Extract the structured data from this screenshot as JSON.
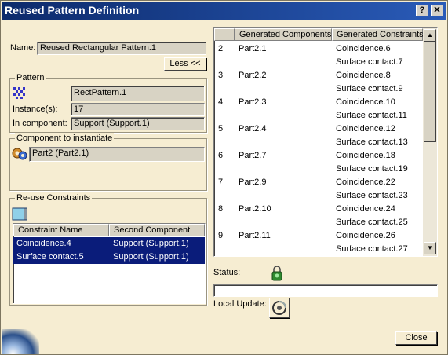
{
  "window": {
    "title": "Reused Pattern Definition",
    "help_button": "?",
    "close_button": "✕"
  },
  "name_section": {
    "label": "Name:",
    "value": "Reused Rectangular Pattern.1",
    "less_button": "Less <<"
  },
  "pattern": {
    "title": "Pattern",
    "pattern_value": "RectPattern.1",
    "instances_label": "Instance(s):",
    "instances_value": "17",
    "component_label": "In component:",
    "component_value": "Support (Support.1)"
  },
  "component_to_instantiate": {
    "title": "Component to instantiate",
    "value": "Part2 (Part2.1)"
  },
  "reuse_constraints": {
    "title": "Re-use Constraints",
    "columns": [
      "Constraint Name",
      "Second Component"
    ],
    "rows": [
      {
        "constraint": "Coincidence.4",
        "second": "Support (Support.1)",
        "selected": true
      },
      {
        "constraint": "Surface contact.5",
        "second": "Support (Support.1)",
        "selected": true
      }
    ]
  },
  "generated": {
    "columns": [
      "",
      "Generated Components",
      "Generated Constraints"
    ],
    "rows": [
      {
        "index": "2",
        "component": "Part2.1",
        "constraints": [
          "Coincidence.6",
          "Surface contact.7"
        ]
      },
      {
        "index": "3",
        "component": "Part2.2",
        "constraints": [
          "Coincidence.8",
          "Surface contact.9"
        ]
      },
      {
        "index": "4",
        "component": "Part2.3",
        "constraints": [
          "Coincidence.10",
          "Surface contact.11"
        ]
      },
      {
        "index": "5",
        "component": "Part2.4",
        "constraints": [
          "Coincidence.12",
          "Surface contact.13"
        ]
      },
      {
        "index": "6",
        "component": "Part2.7",
        "constraints": [
          "Coincidence.18",
          "Surface contact.19"
        ]
      },
      {
        "index": "7",
        "component": "Part2.9",
        "constraints": [
          "Coincidence.22",
          "Surface contact.23"
        ]
      },
      {
        "index": "8",
        "component": "Part2.10",
        "constraints": [
          "Coincidence.24",
          "Surface contact.25"
        ]
      },
      {
        "index": "9",
        "component": "Part2.11",
        "constraints": [
          "Coincidence.26",
          "Surface contact.27"
        ]
      }
    ]
  },
  "status": {
    "label": "Status:",
    "value": ""
  },
  "local_update": {
    "label": "Local Update:"
  },
  "footer": {
    "close_button": "Close"
  },
  "colors": {
    "title_bar": "#0c2a6b",
    "dialog_bg": "#f6edd2",
    "selection": "#0a1c7a"
  },
  "icons": [
    "pattern-icon",
    "component-icon",
    "constraint-icon",
    "status-light-icon",
    "local-update-icon",
    "help-icon",
    "close-icon"
  ]
}
